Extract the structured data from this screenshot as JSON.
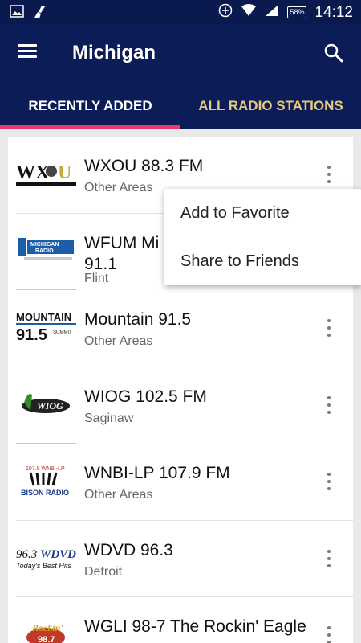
{
  "statusbar": {
    "time": "14:12",
    "battery": "58%"
  },
  "appbar": {
    "title": "Michigan"
  },
  "tabs": [
    {
      "label": "RECENTLY ADDED"
    },
    {
      "label": "ALL RADIO STATIONS"
    }
  ],
  "stations": [
    {
      "name": "WXOU 88.3 FM",
      "area": "Other Areas",
      "logo_text": "WXOU"
    },
    {
      "name": "WFUM Mi\n91.1",
      "area": "Flint",
      "logo_text": "MICHIGAN RADIO"
    },
    {
      "name": "Mountain 91.5",
      "area": "Other Areas",
      "logo_text": "MOUNTAIN 91.5"
    },
    {
      "name": "WIOG 102.5 FM",
      "area": "Saginaw",
      "logo_text": "WIOG"
    },
    {
      "name": "WNBI-LP 107.9 FM",
      "area": "Other Areas",
      "logo_text": "BISON RADIO"
    },
    {
      "name": "WDVD 96.3",
      "area": "Detroit",
      "logo_text": "96.3 WDVD"
    },
    {
      "name": "WGLI 98-7 The Rockin' Eagle",
      "area": "",
      "logo_text": "Rockin'"
    }
  ],
  "popup": {
    "items": [
      "Add to Favorite",
      "Share to Friends"
    ]
  },
  "colors": {
    "appbar": "#0c1c56",
    "indicator": "#e8396a",
    "inactive_tab": "#e7c97c"
  }
}
